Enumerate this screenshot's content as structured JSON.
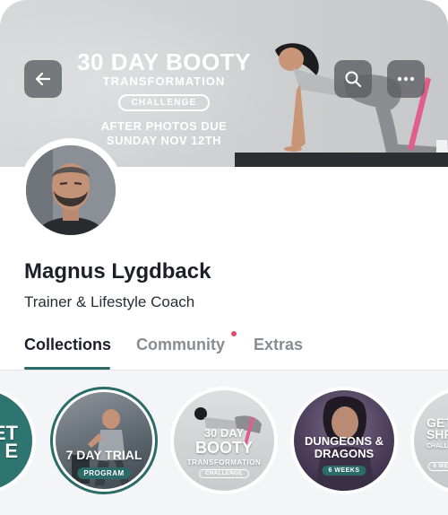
{
  "hero": {
    "promo_title": "30 DAY BOOTY",
    "promo_subtitle": "TRANSFORMATION",
    "promo_pill": "CHALLENGE",
    "promo_due_line1": "AFTER PHOTOS DUE",
    "promo_due_line2": "SUNDAY NOV 12TH"
  },
  "header": {
    "back_icon": "arrow-left-icon",
    "search_icon": "search-icon",
    "more_icon": "more-horizontal-icon"
  },
  "profile": {
    "name": "Magnus Lygdback",
    "role": "Trainer & Lifestyle Coach"
  },
  "tabs": [
    {
      "label": "Collections",
      "active": true
    },
    {
      "label": "Community",
      "active": false,
      "has_notification": true
    },
    {
      "label": "Extras",
      "active": false
    }
  ],
  "collections": [
    {
      "title_lines": [
        "ET",
        "E"
      ],
      "tag": ""
    },
    {
      "title_lines": [
        "7 DAY TRIAL"
      ],
      "tag": "PROGRAM"
    },
    {
      "title_lines": [
        "30 DAY",
        "BOOTY",
        "TRANSFORMATION"
      ],
      "tag": "CHALLENGE"
    },
    {
      "title_lines": [
        "DUNGEONS &",
        "DRAGONS"
      ],
      "tag": "6 WEEKS"
    },
    {
      "title_lines": [
        "GET",
        "SHR",
        "CHALL"
      ],
      "tag": "6 WE"
    }
  ],
  "colors": {
    "accent": "#2b6b68",
    "notification": "#e44d6a",
    "text_primary": "#1c1f2a",
    "text_muted": "#8a8c93"
  }
}
